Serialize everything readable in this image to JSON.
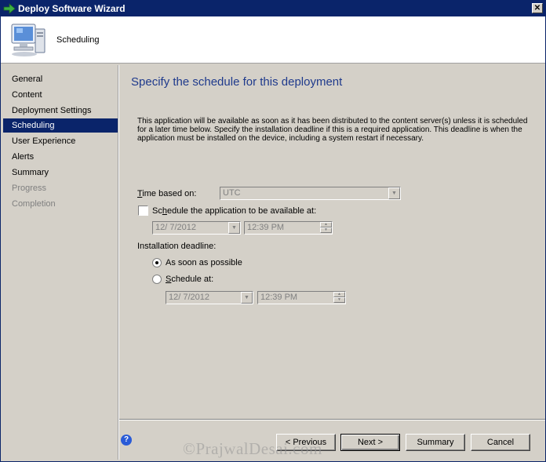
{
  "window": {
    "title": "Deploy Software Wizard",
    "close_glyph": "✕"
  },
  "header": {
    "title": "Scheduling"
  },
  "sidebar": {
    "items": [
      {
        "label": "General",
        "state": "normal"
      },
      {
        "label": "Content",
        "state": "normal"
      },
      {
        "label": "Deployment Settings",
        "state": "normal"
      },
      {
        "label": "Scheduling",
        "state": "active"
      },
      {
        "label": "User Experience",
        "state": "normal"
      },
      {
        "label": "Alerts",
        "state": "normal"
      },
      {
        "label": "Summary",
        "state": "normal"
      },
      {
        "label": "Progress",
        "state": "disabled"
      },
      {
        "label": "Completion",
        "state": "disabled"
      }
    ]
  },
  "main": {
    "heading": "Specify the schedule for this deployment",
    "description": "This application will be available as soon as it has been distributed to the content server(s) unless it is scheduled for a later time below. Specify the installation deadline if this is a required application. This deadline is when the application must be installed on the device, including a system restart if necessary.",
    "time_based_on": {
      "label_prefix": "T",
      "label_rest": "ime based on:",
      "value": "UTC"
    },
    "schedule_available": {
      "label_prefix": "Sc",
      "label_u": "h",
      "label_rest": "edule the application to be available at:",
      "checked": false,
      "date": "12/ 7/2012",
      "time": "12:39 PM"
    },
    "installation_deadline": {
      "label": "Installation deadline:",
      "asap": {
        "label_prefix": "As soon as possible",
        "selected": true
      },
      "schedule_at": {
        "label_prefix": "S",
        "label_rest": "chedule at:",
        "selected": false,
        "date": "12/ 7/2012",
        "time": "12:39 PM"
      }
    }
  },
  "footer": {
    "help_glyph": "?",
    "previous_label": "< Previous",
    "next_label": "Next >",
    "summary_label": "Summary",
    "cancel_label": "Cancel"
  },
  "watermark": "©PrajwalDesai.com",
  "colors": {
    "titlebar": "#0a246a",
    "heading": "#1f3a8c",
    "selection": "#0a246a",
    "background": "#d4d0c8"
  }
}
